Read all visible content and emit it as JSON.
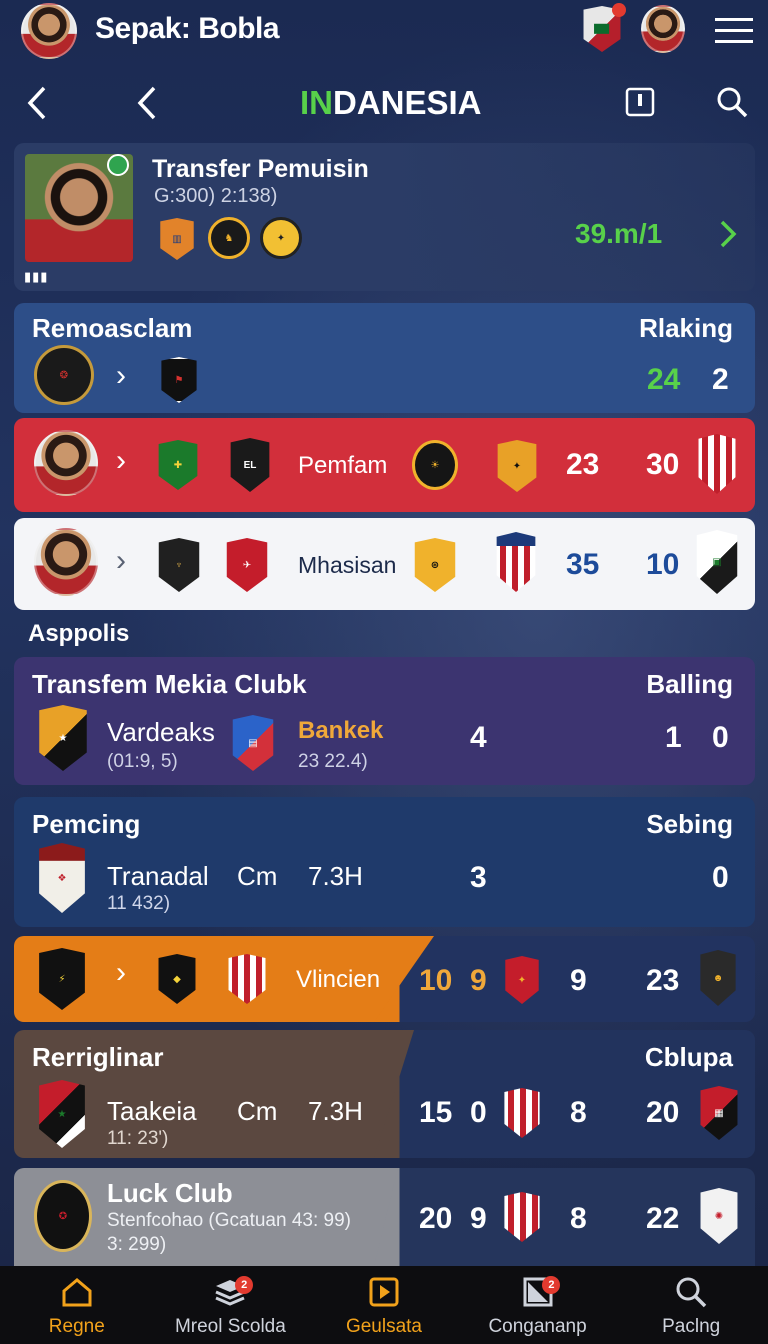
{
  "header": {
    "app_title": "Sepak: Bobla",
    "page_title_accent": "IN",
    "page_title_rest": "DANESIA"
  },
  "featured": {
    "title": "Transfer Pemuisin",
    "subtitle": "G:300) 2:138)",
    "value": "39.m/1",
    "dots": "▮▮▮"
  },
  "ranking_panel": {
    "title": "Remoasclam",
    "right_label": "Rlaking",
    "num_left": "24",
    "num_right": "2"
  },
  "row_red": {
    "label": "Pemfam",
    "num_a": "23",
    "num_b": "30"
  },
  "row_white": {
    "label": "Mhasisan",
    "num_a": "35",
    "num_b": "10"
  },
  "section_label": "Asppolis",
  "purple_panel": {
    "title": "Transfem Mekia Clubk",
    "right_label": "Balling",
    "team_a": "Vardeaks",
    "team_a_sub": "(01:9, 5)",
    "team_b": "Bankek",
    "team_b_sub": "23 22.4)",
    "mid": "4",
    "score_a": "1",
    "score_b": "0"
  },
  "blue_panel": {
    "title": "Pemcing",
    "right_label": "Sebing",
    "team": "Tranadal",
    "team_sub": "11 432)",
    "cm": "Cm",
    "stat": "7.3H",
    "mid": "3",
    "score": "0"
  },
  "orange_row": {
    "label": "Vlincien",
    "num_a": "10",
    "num_b": "9",
    "num_c": "9",
    "num_d": "23"
  },
  "brown_panel": {
    "title": "Rerriglinar",
    "right_label": "Cblupa",
    "team": "Taakeia",
    "team_sub": "11: 23')",
    "cm": "Cm",
    "stat": "7.3H",
    "num_a": "15",
    "num_b": "0",
    "num_c": "8",
    "num_d": "20"
  },
  "grey_panel": {
    "title": "Luck Club",
    "subtitle": "Stenfcohao (Gcatuan 43: 99)",
    "subtitle2": "3: 299)",
    "num_a": "20",
    "num_b": "9",
    "num_c": "8",
    "num_d": "22"
  },
  "nav": {
    "items": [
      {
        "label": "Regne",
        "icon": "home-icon",
        "badge": ""
      },
      {
        "label": "Mreol Scolda",
        "icon": "layers-icon",
        "badge": "2"
      },
      {
        "label": "Geulsata",
        "icon": "play-icon",
        "badge": ""
      },
      {
        "label": "Congananp",
        "icon": "screen-icon",
        "badge": "2"
      },
      {
        "label": "Paclng",
        "icon": "search-icon",
        "badge": ""
      }
    ]
  },
  "colors": {
    "accent_green": "#58d14a",
    "red_row": "#d22f3b",
    "orange_row": "#e47d17",
    "purple_panel": "#3c3470",
    "blue_panel": "#1f3a6b",
    "nav_active": "#f2a21b"
  }
}
